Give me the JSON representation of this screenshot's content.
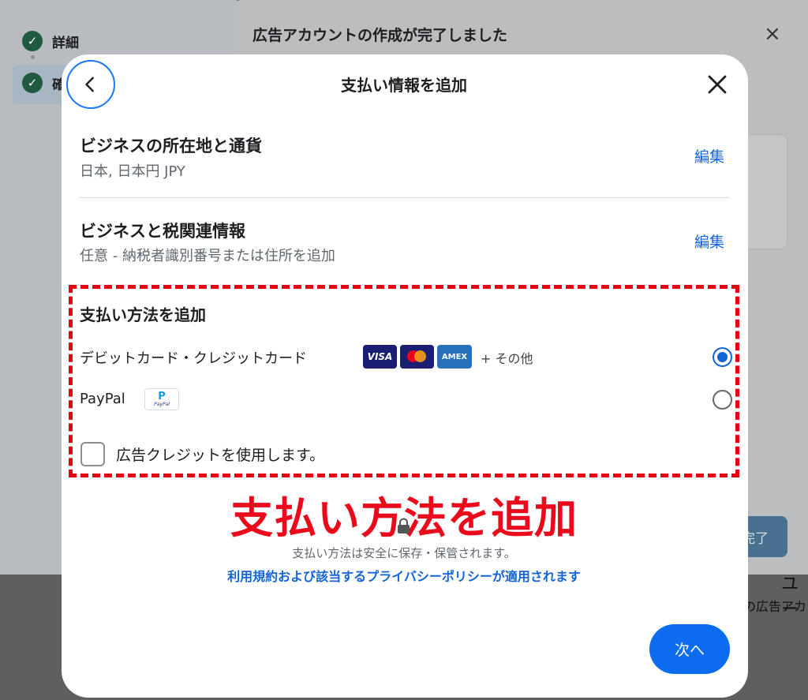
{
  "background": {
    "steps": [
      {
        "label": "詳細"
      },
      {
        "label": "確"
      }
    ],
    "panel_title": "広告アカウントの作成が完了しました",
    "close_glyph": "×",
    "done_button_fragment": "完了",
    "bottom_fragment_1": "ユー",
    "bottom_fragment_2": "の広告アカ"
  },
  "modal": {
    "title": "支払い情報を追加",
    "sections": [
      {
        "title": "ビジネスの所在地と通貨",
        "subtitle": "日本, 日本円 JPY",
        "edit_label": "編集"
      },
      {
        "title": "ビジネスと税関連情報",
        "subtitle": "任意 - 納税者識別番号または住所を追加",
        "edit_label": "編集"
      }
    ],
    "payment": {
      "title": "支払い方法を追加",
      "options": [
        {
          "label": "デビットカード・クレジットカード",
          "selected": true,
          "logos": [
            "VISA",
            "Mastercard",
            "AMEX"
          ],
          "more": "+ その他"
        },
        {
          "label": "PayPal",
          "selected": false,
          "logos": [
            "PayPal"
          ]
        }
      ],
      "ad_credit_label": "広告クレジットを使用します。",
      "ad_credit_checked": false
    },
    "annotation": "支払い方法を追加",
    "secure_text": "支払い方法は安全に保存・保管されます。",
    "policy_link": "利用規約および該当するプライバシーポリシーが適用されます",
    "next_button": "次へ"
  },
  "logos_text": {
    "visa": "VISA",
    "amex": "AMEX",
    "paypal_mark": "P",
    "paypal_word": "PayPal"
  },
  "colors": {
    "accent_blue": "#1464d8",
    "button_blue": "#0b6cf0",
    "annotation_red": "#ea0a1c"
  }
}
